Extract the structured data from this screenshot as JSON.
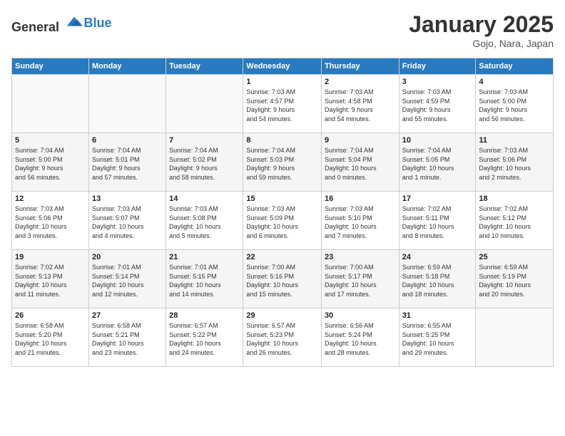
{
  "header": {
    "logo_general": "General",
    "logo_blue": "Blue",
    "title": "January 2025",
    "subtitle": "Gojo, Nara, Japan"
  },
  "weekdays": [
    "Sunday",
    "Monday",
    "Tuesday",
    "Wednesday",
    "Thursday",
    "Friday",
    "Saturday"
  ],
  "weeks": [
    [
      {
        "day": "",
        "info": ""
      },
      {
        "day": "",
        "info": ""
      },
      {
        "day": "",
        "info": ""
      },
      {
        "day": "1",
        "info": "Sunrise: 7:03 AM\nSunset: 4:57 PM\nDaylight: 9 hours\nand 54 minutes."
      },
      {
        "day": "2",
        "info": "Sunrise: 7:03 AM\nSunset: 4:58 PM\nDaylight: 9 hours\nand 54 minutes."
      },
      {
        "day": "3",
        "info": "Sunrise: 7:03 AM\nSunset: 4:59 PM\nDaylight: 9 hours\nand 55 minutes."
      },
      {
        "day": "4",
        "info": "Sunrise: 7:03 AM\nSunset: 5:00 PM\nDaylight: 9 hours\nand 56 minutes."
      }
    ],
    [
      {
        "day": "5",
        "info": "Sunrise: 7:04 AM\nSunset: 5:00 PM\nDaylight: 9 hours\nand 56 minutes."
      },
      {
        "day": "6",
        "info": "Sunrise: 7:04 AM\nSunset: 5:01 PM\nDaylight: 9 hours\nand 57 minutes."
      },
      {
        "day": "7",
        "info": "Sunrise: 7:04 AM\nSunset: 5:02 PM\nDaylight: 9 hours\nand 58 minutes."
      },
      {
        "day": "8",
        "info": "Sunrise: 7:04 AM\nSunset: 5:03 PM\nDaylight: 9 hours\nand 59 minutes."
      },
      {
        "day": "9",
        "info": "Sunrise: 7:04 AM\nSunset: 5:04 PM\nDaylight: 10 hours\nand 0 minutes."
      },
      {
        "day": "10",
        "info": "Sunrise: 7:04 AM\nSunset: 5:05 PM\nDaylight: 10 hours\nand 1 minute."
      },
      {
        "day": "11",
        "info": "Sunrise: 7:03 AM\nSunset: 5:06 PM\nDaylight: 10 hours\nand 2 minutes."
      }
    ],
    [
      {
        "day": "12",
        "info": "Sunrise: 7:03 AM\nSunset: 5:06 PM\nDaylight: 10 hours\nand 3 minutes."
      },
      {
        "day": "13",
        "info": "Sunrise: 7:03 AM\nSunset: 5:07 PM\nDaylight: 10 hours\nand 4 minutes."
      },
      {
        "day": "14",
        "info": "Sunrise: 7:03 AM\nSunset: 5:08 PM\nDaylight: 10 hours\nand 5 minutes."
      },
      {
        "day": "15",
        "info": "Sunrise: 7:03 AM\nSunset: 5:09 PM\nDaylight: 10 hours\nand 6 minutes."
      },
      {
        "day": "16",
        "info": "Sunrise: 7:03 AM\nSunset: 5:10 PM\nDaylight: 10 hours\nand 7 minutes."
      },
      {
        "day": "17",
        "info": "Sunrise: 7:02 AM\nSunset: 5:11 PM\nDaylight: 10 hours\nand 8 minutes."
      },
      {
        "day": "18",
        "info": "Sunrise: 7:02 AM\nSunset: 5:12 PM\nDaylight: 10 hours\nand 10 minutes."
      }
    ],
    [
      {
        "day": "19",
        "info": "Sunrise: 7:02 AM\nSunset: 5:13 PM\nDaylight: 10 hours\nand 11 minutes."
      },
      {
        "day": "20",
        "info": "Sunrise: 7:01 AM\nSunset: 5:14 PM\nDaylight: 10 hours\nand 12 minutes."
      },
      {
        "day": "21",
        "info": "Sunrise: 7:01 AM\nSunset: 5:15 PM\nDaylight: 10 hours\nand 14 minutes."
      },
      {
        "day": "22",
        "info": "Sunrise: 7:00 AM\nSunset: 5:16 PM\nDaylight: 10 hours\nand 15 minutes."
      },
      {
        "day": "23",
        "info": "Sunrise: 7:00 AM\nSunset: 5:17 PM\nDaylight: 10 hours\nand 17 minutes."
      },
      {
        "day": "24",
        "info": "Sunrise: 6:59 AM\nSunset: 5:18 PM\nDaylight: 10 hours\nand 18 minutes."
      },
      {
        "day": "25",
        "info": "Sunrise: 6:59 AM\nSunset: 5:19 PM\nDaylight: 10 hours\nand 20 minutes."
      }
    ],
    [
      {
        "day": "26",
        "info": "Sunrise: 6:58 AM\nSunset: 5:20 PM\nDaylight: 10 hours\nand 21 minutes."
      },
      {
        "day": "27",
        "info": "Sunrise: 6:58 AM\nSunset: 5:21 PM\nDaylight: 10 hours\nand 23 minutes."
      },
      {
        "day": "28",
        "info": "Sunrise: 6:57 AM\nSunset: 5:22 PM\nDaylight: 10 hours\nand 24 minutes."
      },
      {
        "day": "29",
        "info": "Sunrise: 6:57 AM\nSunset: 5:23 PM\nDaylight: 10 hours\nand 26 minutes."
      },
      {
        "day": "30",
        "info": "Sunrise: 6:56 AM\nSunset: 5:24 PM\nDaylight: 10 hours\nand 28 minutes."
      },
      {
        "day": "31",
        "info": "Sunrise: 6:55 AM\nSunset: 5:25 PM\nDaylight: 10 hours\nand 29 minutes."
      },
      {
        "day": "",
        "info": ""
      }
    ]
  ]
}
